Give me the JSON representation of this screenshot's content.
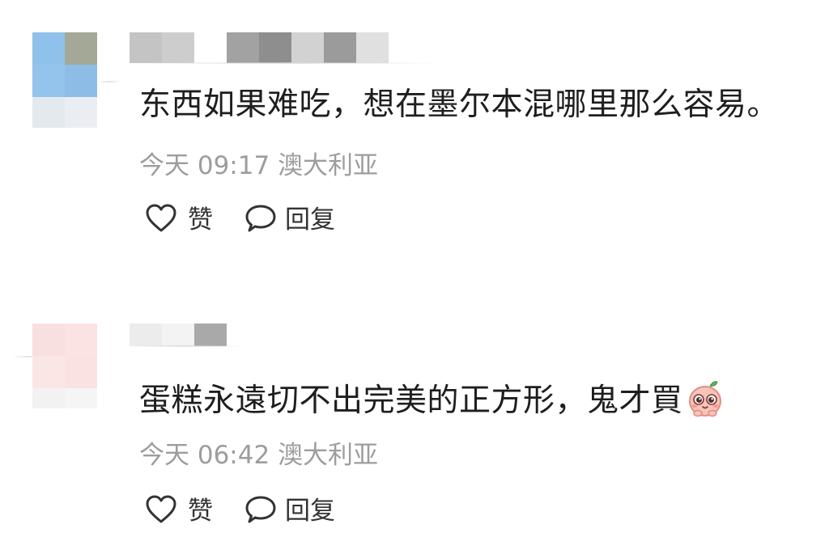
{
  "comments": [
    {
      "text": "东西如果难吃，想在墨尔本混哪里那么容易。",
      "time": "今天 09:17",
      "location": "澳大利亚",
      "like_label": "赞",
      "reply_label": "回复"
    },
    {
      "text": "蛋糕永遠切不出完美的正方形，鬼才買",
      "emoji": "smiling-peach-emoji",
      "time": "今天 06:42",
      "location": "澳大利亚",
      "like_label": "赞",
      "reply_label": "回复"
    }
  ],
  "colors": {
    "comment_text": "#1e1e1e",
    "meta_text": "#9d9d9d",
    "action": "#333333"
  },
  "icons": {
    "like": "heart-outline-icon",
    "reply": "speech-bubble-outline-icon"
  }
}
